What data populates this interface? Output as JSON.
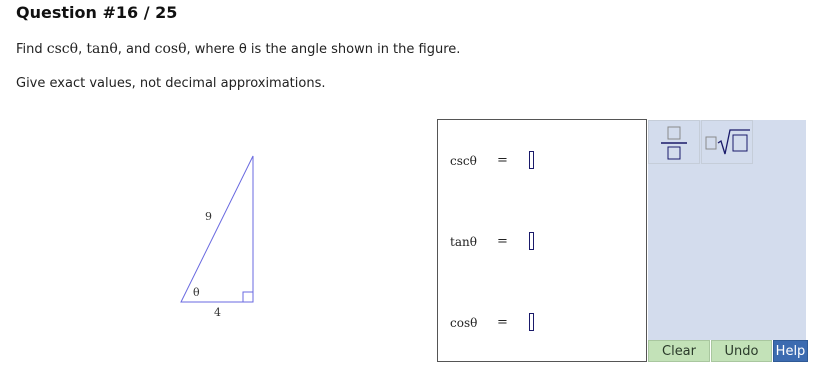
{
  "question": {
    "title": "Question #16 / 25"
  },
  "prompt": {
    "p1": "Find ",
    "csc": "cscθ",
    "c1": ", ",
    "tan": "tanθ",
    "c2": ", and ",
    "cos": "cosθ",
    "p2": ", where θ is the angle shown in the figure.",
    "instructions": "Give exact values, not decimal approximations."
  },
  "figure": {
    "hypotenuse_label": "9",
    "base_label": "4",
    "angle_label": "θ"
  },
  "answers": [
    {
      "fn": "cscθ",
      "eq": "=",
      "value": ""
    },
    {
      "fn": "tanθ",
      "eq": "=",
      "value": ""
    },
    {
      "fn": "cosθ",
      "eq": "=",
      "value": ""
    }
  ],
  "palette": {
    "tools": [
      "fraction-icon",
      "sqrt-icon"
    ]
  },
  "buttons": {
    "clear": "Clear",
    "undo": "Undo",
    "help": "Help"
  },
  "colors": {
    "triangle": "#6a6ae0",
    "palette_bg": "#d3dced",
    "action_green": "#c3e2b8",
    "help_blue": "#3c6bb0"
  }
}
